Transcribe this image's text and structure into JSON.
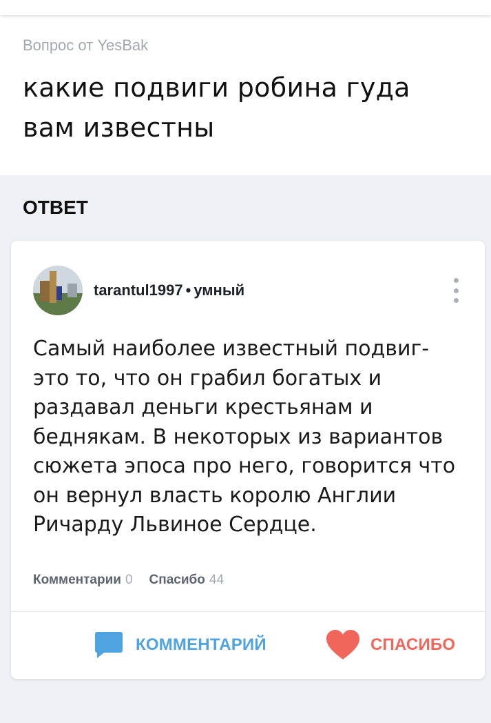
{
  "question": {
    "author_line": "Вопрос от YesBak",
    "title": "какие подвиги робина гуда вам известны"
  },
  "answers_heading": "ОТВЕТ",
  "answer": {
    "author": "tarantul1997",
    "separator": "•",
    "rank": "умный",
    "text": "Самый наиболее известный подвиг- это то, что он грабил богатых и раздавал деньги крестьянам и беднякам. В некоторых из вариантов сюжета эпоса про него, говорится что он вернул власть королю Англии Ричарду Львиное Сердце.",
    "stats": {
      "comments_label": "Комментарии",
      "comments_count": "0",
      "thanks_label": "Спасибо",
      "thanks_count": "44"
    },
    "actions": {
      "comment_label": "КОММЕНТАРИЙ",
      "thanks_label": "СПАСИБО"
    }
  },
  "colors": {
    "comment_accent": "#4fa3e0",
    "thanks_accent": "#f0665a",
    "page_bg": "#eef1f5"
  },
  "icons": {
    "menu": "more-vertical-icon",
    "comment": "speech-bubble-icon",
    "thanks": "heart-icon"
  }
}
